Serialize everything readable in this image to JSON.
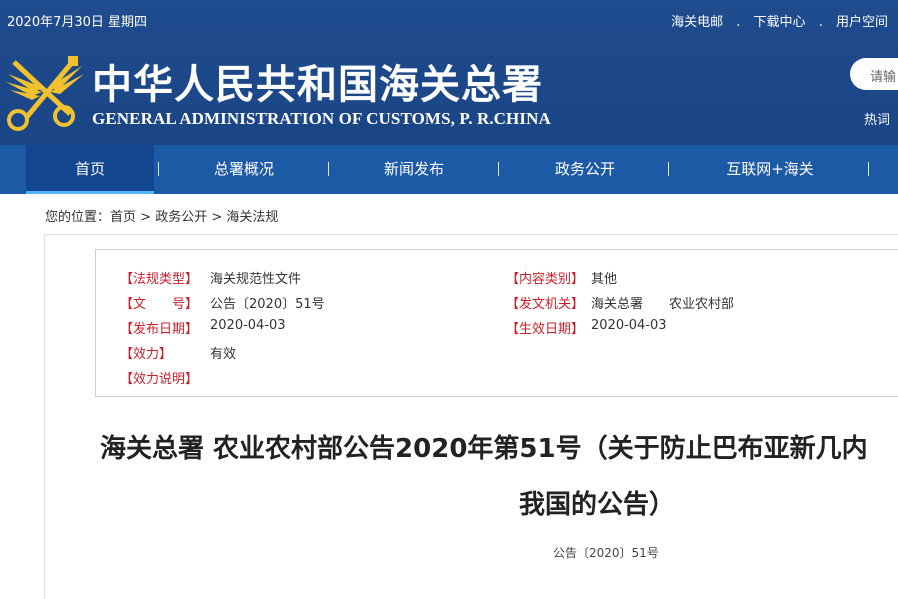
{
  "header": {
    "date": "2020年7月30日 星期四",
    "top_links": [
      "海关电邮",
      "下载中心",
      "用户空间"
    ],
    "top_link_separator": ".",
    "title_cn": "中华人民共和国海关总署",
    "title_en": "GENERAL ADMINISTRATION OF CUSTOMS, P. R.CHINA",
    "search_placeholder": "请输",
    "hot_words": "热词",
    "logo_icon": "customs-emblem-icon",
    "colors": {
      "header_bg": "#1f4c8f",
      "nav_bg": "#1d5aa6",
      "nav_active": "#12468e",
      "label_red": "#c8202a"
    }
  },
  "nav": {
    "items": [
      "首页",
      "总署概况",
      "新闻发布",
      "政务公开",
      "互联网+海关"
    ],
    "active_index": 0,
    "separator": "|"
  },
  "breadcrumb": {
    "prefix": "您的位置：",
    "items": [
      "首页",
      "政务公开",
      "海关法规"
    ],
    "separator": ">"
  },
  "meta": {
    "left": [
      {
        "label": "【法规类型】",
        "value": "海关规范性文件"
      },
      {
        "label": "【文　　号】",
        "value": "公告〔2020〕51号"
      },
      {
        "label": "【发布日期】",
        "value": "2020-04-03"
      },
      {
        "label": "【效力】",
        "value": "有效"
      },
      {
        "label": "【效力说明】",
        "value": ""
      }
    ],
    "right": [
      {
        "label": "【内容类别】",
        "value": "其他"
      },
      {
        "label": "【发文机关】",
        "value": "海关总署　　农业农村部"
      },
      {
        "label": "【生效日期】",
        "value": "2020-04-03"
      }
    ]
  },
  "article": {
    "title_line1": "海关总署 农业农村部公告2020年第51号（关于防止巴布亚新几内",
    "title_line2": "我国的公告）",
    "doc_number": "公告〔2020〕51号"
  }
}
